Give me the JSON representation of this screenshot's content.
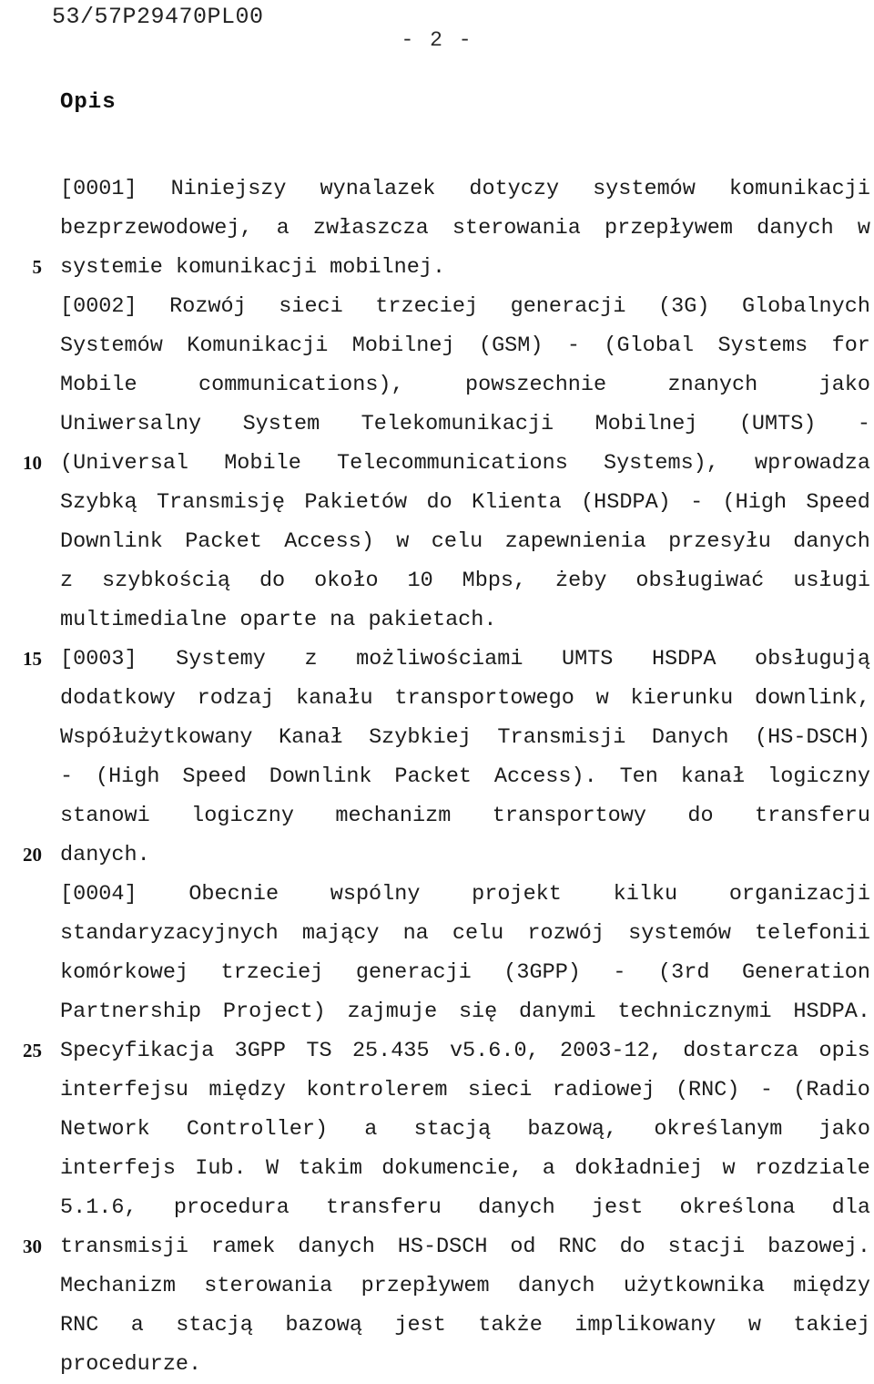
{
  "header": {
    "reference": "53/57P29470PL00",
    "page_label": "- 2 -"
  },
  "section": {
    "title": "Opis"
  },
  "document": {
    "language": "pl",
    "line_number_interval": 5,
    "lines": [
      {
        "n": "",
        "text": "[0001] Niniejszy wynalazek dotyczy systemów komunikacji",
        "justify": true
      },
      {
        "n": "",
        "text": "bezprzewodowej, a zwłaszcza sterowania przepływem danych w",
        "justify": true
      },
      {
        "n": "5",
        "text": "systemie komunikacji mobilnej.",
        "justify": false
      },
      {
        "n": "",
        "text": "[0002] Rozwój sieci trzeciej generacji (3G) Globalnych",
        "justify": true
      },
      {
        "n": "",
        "text": "Systemów Komunikacji Mobilnej (GSM) - (Global Systems for",
        "justify": true
      },
      {
        "n": "",
        "text": "Mobile communications), powszechnie znanych jako",
        "justify": true
      },
      {
        "n": "",
        "text": "Uniwersalny System Telekomunikacji Mobilnej (UMTS) -",
        "justify": true
      },
      {
        "n": "10",
        "text": "(Universal Mobile Telecommunications Systems), wprowadza",
        "justify": true
      },
      {
        "n": "",
        "text": "Szybką Transmisję Pakietów do Klienta (HSDPA) - (High Speed",
        "justify": true
      },
      {
        "n": "",
        "text": "Downlink Packet Access) w celu zapewnienia przesyłu danych",
        "justify": true
      },
      {
        "n": "",
        "text": "z szybkością do około 10 Mbps, żeby obsługiwać usługi",
        "justify": true
      },
      {
        "n": "",
        "text": "multimedialne oparte na pakietach.",
        "justify": false
      },
      {
        "n": "15",
        "text": "[0003] Systemy z możliwościami UMTS HSDPA obsługują",
        "justify": true
      },
      {
        "n": "",
        "text": "dodatkowy rodzaj kanału transportowego w kierunku downlink,",
        "justify": true
      },
      {
        "n": "",
        "text": "Współużytkowany Kanał Szybkiej Transmisji Danych (HS-DSCH)",
        "justify": true
      },
      {
        "n": "",
        "text": "- (High Speed Downlink Packet Access). Ten kanał logiczny",
        "justify": true
      },
      {
        "n": "",
        "text": "stanowi logiczny mechanizm transportowy do transferu",
        "justify": true
      },
      {
        "n": "20",
        "text": "danych.",
        "justify": false
      },
      {
        "n": "",
        "text": "[0004] Obecnie wspólny projekt kilku organizacji",
        "justify": true
      },
      {
        "n": "",
        "text": "standaryzacyjnych mający na celu rozwój systemów telefonii",
        "justify": true
      },
      {
        "n": "",
        "text": "komórkowej trzeciej generacji (3GPP) - (3rd Generation",
        "justify": true
      },
      {
        "n": "",
        "text": "Partnership Project) zajmuje się danymi technicznymi HSDPA.",
        "justify": true
      },
      {
        "n": "25",
        "text": "Specyfikacja 3GPP TS 25.435 v5.6.0, 2003-12, dostarcza opis",
        "justify": true
      },
      {
        "n": "",
        "text": "interfejsu między kontrolerem sieci radiowej (RNC) - (Radio",
        "justify": true
      },
      {
        "n": "",
        "text": "Network Controller) a stacją bazową, określanym jako",
        "justify": true
      },
      {
        "n": "",
        "text": "interfejs Iub. W takim dokumencie, a dokładniej w rozdziale",
        "justify": true
      },
      {
        "n": "",
        "text": "5.1.6, procedura transferu danych jest określona dla",
        "justify": true
      },
      {
        "n": "30",
        "text": "transmisji ramek danych HS-DSCH od RNC do stacji bazowej.",
        "justify": true
      },
      {
        "n": "",
        "text": "Mechanizm sterowania przepływem danych użytkownika między",
        "justify": true
      },
      {
        "n": "",
        "text": "RNC a stacją bazową jest także implikowany w takiej",
        "justify": true
      },
      {
        "n": "",
        "text": "procedurze.",
        "justify": false
      }
    ]
  }
}
